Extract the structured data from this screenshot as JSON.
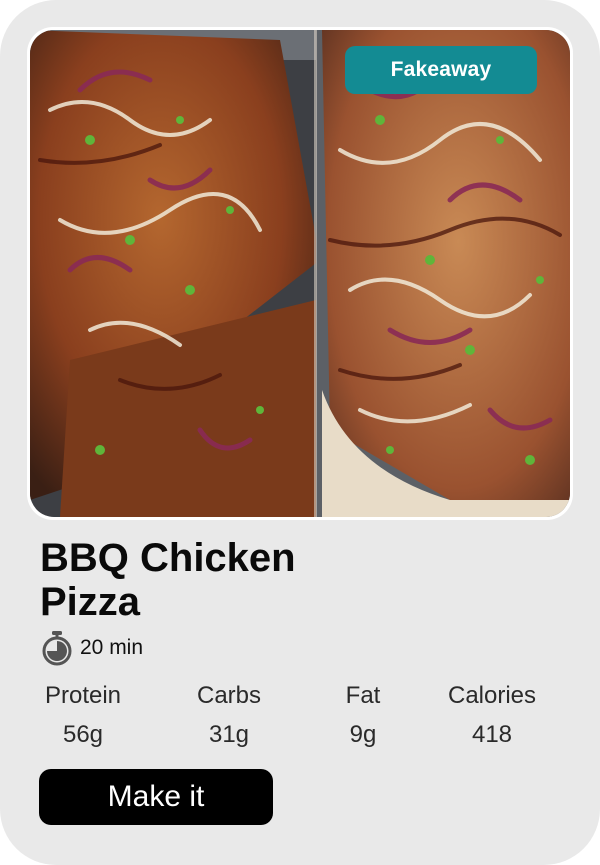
{
  "recipe": {
    "badge": "Fakeaway",
    "title_line1": "BBQ Chicken",
    "title_line2": "Pizza",
    "time": "20 min",
    "time_icon": "stopwatch-icon",
    "image_description_icon": "pizza-photo",
    "badge_color": "#138b93"
  },
  "nutrition": [
    {
      "label": "Protein",
      "value": "56g"
    },
    {
      "label": "Carbs",
      "value": "31g"
    },
    {
      "label": "Fat",
      "value": "9g"
    },
    {
      "label": "Calories",
      "value": "418"
    }
  ],
  "actions": {
    "make_it_label": "Make it"
  }
}
